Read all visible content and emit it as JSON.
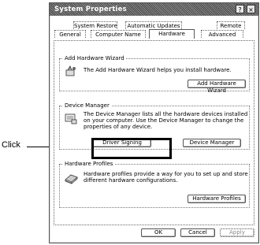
{
  "window": {
    "title": "System Properties",
    "help_btn": "?",
    "close_btn": "×"
  },
  "tabs": {
    "row1": [
      "System Restore",
      "Automatic Updates",
      "Remote"
    ],
    "row2": [
      "General",
      "Computer Name",
      "Hardware",
      "Advanced"
    ],
    "active": "Hardware"
  },
  "add_hardware": {
    "group_title": "Add Hardware Wizard",
    "description": "The Add Hardware Wizard helps you install hardware.",
    "button": "Add Hardware Wizard"
  },
  "device_manager": {
    "group_title": "Device Manager",
    "description_lines": [
      "The Device Manager lists all the hardware devices installed",
      "on your computer. Use the Device Manager to change the",
      "properties of any device."
    ],
    "driver_signing_button": "Driver Signing",
    "device_manager_button": "Device Manager"
  },
  "hardware_profiles": {
    "group_title": "Hardware Profiles",
    "description_lines": [
      "Hardware profiles provide a way for you to set up and store",
      "different hardware configurations."
    ],
    "button": "Hardware Profiles"
  },
  "footer": {
    "ok": "OK",
    "cancel": "Cancel",
    "apply": "Apply"
  },
  "callout": {
    "label": "Click"
  }
}
